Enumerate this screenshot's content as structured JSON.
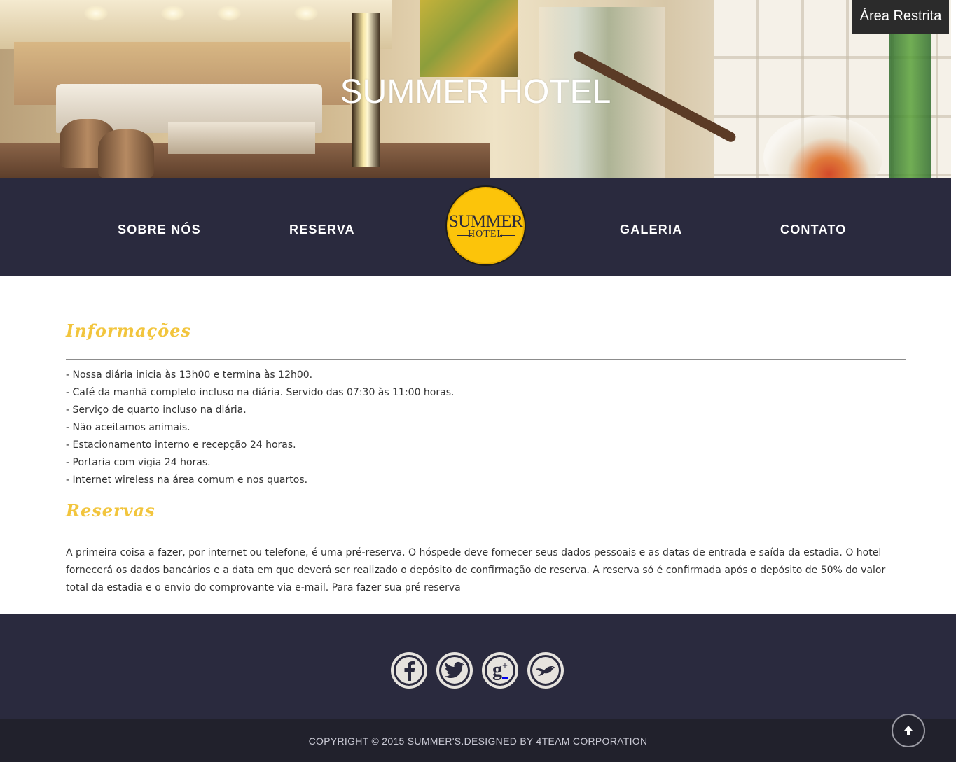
{
  "hero": {
    "title": "SUMMER HOTEL",
    "restricted_link": "Área Restrita"
  },
  "nav": {
    "items": [
      "SOBRE NÓS",
      "RESERVA",
      "GALERIA",
      "CONTATO"
    ],
    "logo_text": "SUMMER",
    "logo_sub": "HOTEL"
  },
  "informacoes": {
    "title": "Informações",
    "items": [
      "- Nossa diária inicia às 13h00 e termina às 12h00.",
      "- Café da manhã completo incluso na diária. Servido das 07:30 às 11:00 horas.",
      "- Serviço de quarto incluso na diária.",
      "- Não aceitamos animais.",
      "- Estacionamento interno e recepção 24 horas.",
      "- Portaria com vigia 24 horas.",
      "- Internet wireless na área comum e nos quartos."
    ]
  },
  "reservas": {
    "title": "Reservas",
    "text": "A primeira coisa a fazer, por internet ou telefone, é uma pré-reserva. O hóspede deve fornecer seus dados pessoais e as datas de entrada e saída da estadia. O hotel fornecerá os dados bancários e a data em que deverá ser realizado o depósito de confirmação de reserva.  A reserva só é confirmada após o depósito de 50% do valor total da estadia e o envio do comprovante via e-mail. Para fazer sua pré reserva"
  },
  "footer": {
    "social_icons": [
      "facebook-icon",
      "twitter-icon",
      "google-plus-icon",
      "bird-icon"
    ],
    "copyright": "COPYRIGHT © 2015 SUMMER'S.DESIGNED BY 4TEAM CORPORATION"
  },
  "colors": {
    "nav_bg": "#2a2a3e",
    "accent_gold": "#f2c53d",
    "logo_yellow": "#fcc40a",
    "bottom_bar": "#21212c"
  }
}
